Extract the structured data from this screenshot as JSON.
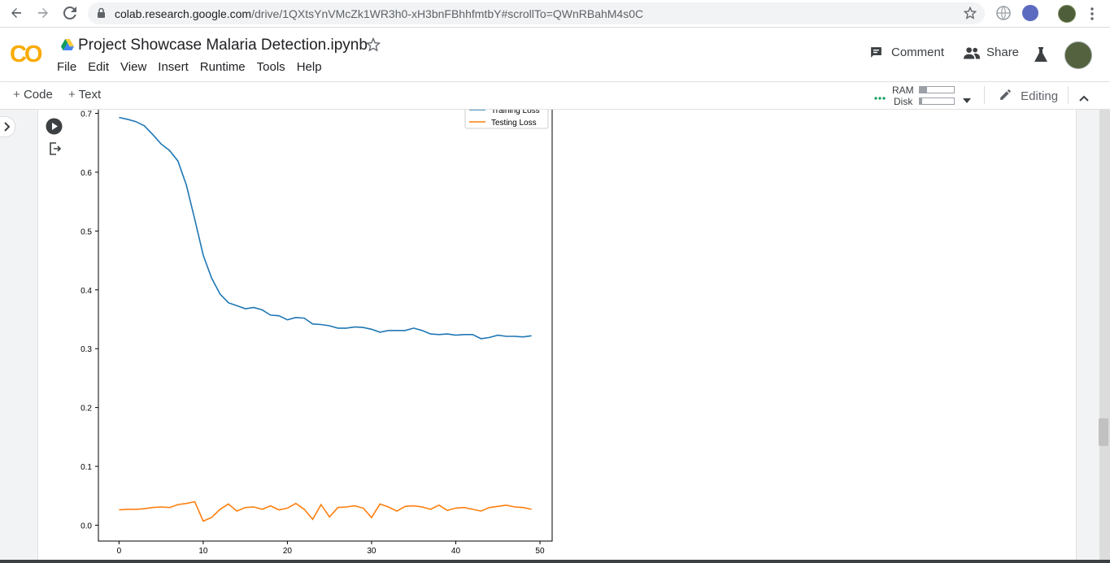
{
  "browser": {
    "url_host": "colab.research.google.com",
    "url_rest": "/drive/1QXtsYnVMcZk1WR3h0-xH3bnFBhhfmtbY#scrollTo=QWnRBahM4s0C",
    "icons": [
      "back-icon",
      "forward-icon",
      "reload-icon",
      "lock-icon",
      "star-icon",
      "globe-icon",
      "extension-icon",
      "profile-avatar",
      "kebab-menu-icon"
    ]
  },
  "header": {
    "logo": "CO",
    "notebook_title": "Project Showcase Malaria Detection.ipynb",
    "menu": [
      "File",
      "Edit",
      "View",
      "Insert",
      "Runtime",
      "Tools",
      "Help"
    ],
    "comment_label": "Comment",
    "share_label": "Share"
  },
  "toolbar": {
    "code_label": "Code",
    "text_label": "Text",
    "ram_label": "RAM",
    "disk_label": "Disk",
    "ram_usage": 0.22,
    "disk_usage": 0.08,
    "editing_label": "Editing"
  },
  "colors": {
    "training": "#1f77b4",
    "testing": "#ff7f0e",
    "colab_logo": "#f9ab00"
  },
  "chart_data": {
    "type": "line",
    "x": [
      0,
      1,
      2,
      3,
      4,
      5,
      6,
      7,
      8,
      9,
      10,
      11,
      12,
      13,
      14,
      15,
      16,
      17,
      18,
      19,
      20,
      21,
      22,
      23,
      24,
      25,
      26,
      27,
      28,
      29,
      30,
      31,
      32,
      33,
      34,
      35,
      36,
      37,
      38,
      39,
      40,
      41,
      42,
      43,
      44,
      45,
      46,
      47,
      48,
      49
    ],
    "series": [
      {
        "name": "Training Loss",
        "color": "#1f77b4",
        "values": [
          0.693,
          0.69,
          0.686,
          0.679,
          0.664,
          0.648,
          0.637,
          0.619,
          0.578,
          0.52,
          0.459,
          0.42,
          0.393,
          0.378,
          0.373,
          0.368,
          0.37,
          0.366,
          0.357,
          0.356,
          0.349,
          0.353,
          0.352,
          0.342,
          0.341,
          0.339,
          0.335,
          0.335,
          0.337,
          0.336,
          0.333,
          0.328,
          0.331,
          0.331,
          0.331,
          0.335,
          0.331,
          0.325,
          0.324,
          0.325,
          0.323,
          0.324,
          0.324,
          0.317,
          0.319,
          0.323,
          0.321,
          0.321,
          0.32,
          0.322
        ]
      },
      {
        "name": "Testing Loss",
        "color": "#ff7f0e",
        "values": [
          0.026,
          0.027,
          0.027,
          0.028,
          0.03,
          0.031,
          0.03,
          0.035,
          0.037,
          0.04,
          0.007,
          0.013,
          0.027,
          0.036,
          0.024,
          0.03,
          0.031,
          0.027,
          0.033,
          0.026,
          0.029,
          0.037,
          0.027,
          0.01,
          0.035,
          0.014,
          0.03,
          0.031,
          0.033,
          0.029,
          0.013,
          0.036,
          0.031,
          0.024,
          0.032,
          0.033,
          0.031,
          0.027,
          0.034,
          0.025,
          0.029,
          0.03,
          0.027,
          0.024,
          0.03,
          0.032,
          0.034,
          0.031,
          0.03,
          0.027
        ]
      }
    ],
    "xticks": [
      0,
      10,
      20,
      30,
      40,
      50
    ],
    "yticks": [
      0.0,
      0.1,
      0.2,
      0.3,
      0.4,
      0.5,
      0.6,
      0.7
    ],
    "xlim": [
      -2.45,
      51.45
    ],
    "ylim": [
      -0.027,
      0.727
    ],
    "legend": "top-right",
    "grid": false
  }
}
